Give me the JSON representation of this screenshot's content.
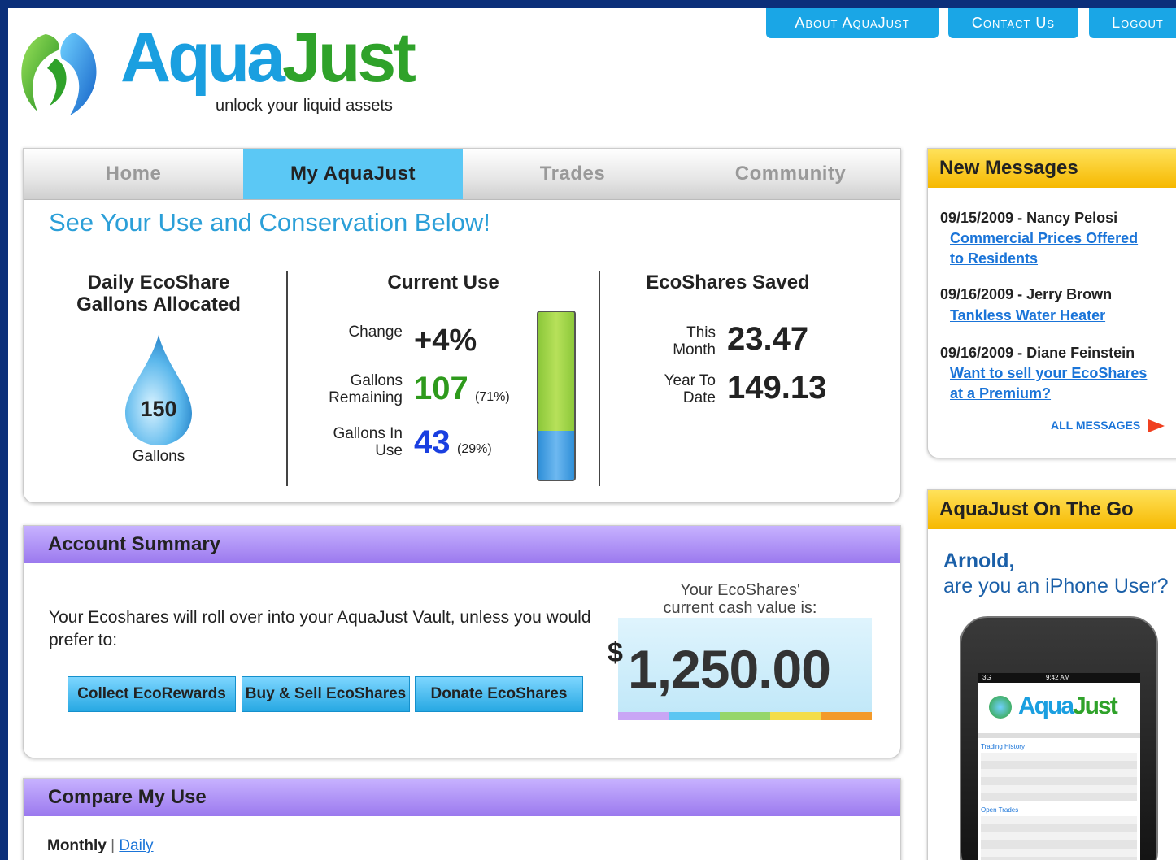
{
  "top_nav": {
    "about": "About AquaJust",
    "contact": "Contact Us",
    "logout": "Logout"
  },
  "brand": {
    "name_part1": "Aqua",
    "name_part2": "Just",
    "tagline": "unlock your liquid assets"
  },
  "tabs": [
    "Home",
    "My AquaJust",
    "Trades",
    "Community"
  ],
  "active_tab": "My AquaJust",
  "conservation": {
    "title": "See Your Use and Conservation Below!",
    "allocated": {
      "heading_line1": "Daily EcoShare",
      "heading_line2": "Gallons Allocated",
      "value": "150",
      "unit": "Gallons"
    },
    "current_use": {
      "heading": "Current Use",
      "change_label": "Change",
      "change_value": "+4%",
      "remaining_label_line1": "Gallons",
      "remaining_label_line2": "Remaining",
      "remaining_value": "107",
      "remaining_pct": "(71%)",
      "inuse_label_line1": "Gallons In",
      "inuse_label_line2": "Use",
      "inuse_value": "43",
      "inuse_pct": "(29%)",
      "gauge_remaining_fraction": 0.71,
      "gauge_inuse_fraction": 0.29
    },
    "saved": {
      "heading": "EcoShares Saved",
      "month_label_line1": "This",
      "month_label_line2": "Month",
      "month_value": "23.47",
      "ytd_label_line1": "Year To",
      "ytd_label_line2": "Date",
      "ytd_value": "149.13"
    }
  },
  "account_summary": {
    "header": "Account Summary",
    "text": "Your Ecoshares will roll over into your AquaJust Vault, unless you would prefer to:",
    "buttons": [
      "Collect EcoRewards",
      "Buy & Sell EcoShares",
      "Donate EcoShares"
    ],
    "cash_label_line1": "Your EcoShares'",
    "cash_label_line2": "current cash value is:",
    "cash_currency": "$",
    "cash_value": "1,250.00"
  },
  "compare": {
    "header": "Compare My Use",
    "monthly": "Monthly",
    "separator": "|",
    "daily": "Daily"
  },
  "messages": {
    "header": "New Messages",
    "items": [
      {
        "meta": "09/15/2009 - Nancy Pelosi",
        "link_line1": "Commercial Prices Offered",
        "link_line2": "to Residents"
      },
      {
        "meta": "09/16/2009 - Jerry Brown",
        "link_line1": "Tankless Water Heater",
        "link_line2": ""
      },
      {
        "meta": "09/16/2009 - Diane Feinstein",
        "link_line1": "Want to sell your EcoShares",
        "link_line2": "at a Premium?"
      }
    ],
    "all_label": "ALL MESSAGES"
  },
  "on_the_go": {
    "header": "AquaJust On The Go",
    "greeting_name": "Arnold,",
    "question": "are you an iPhone User?",
    "phone_time": "9:42 AM",
    "phone_carrier": "3G",
    "phone_section1": "Trading History",
    "phone_section2": "Open Trades"
  },
  "colors": {
    "nav_button": "#1aa6e6",
    "active_tab": "#5bc8f5",
    "section_header": "#9b79ee",
    "side_header": "#f6b800",
    "remaining_green": "#2e9a1c",
    "inuse_blue": "#1a3fe0"
  }
}
